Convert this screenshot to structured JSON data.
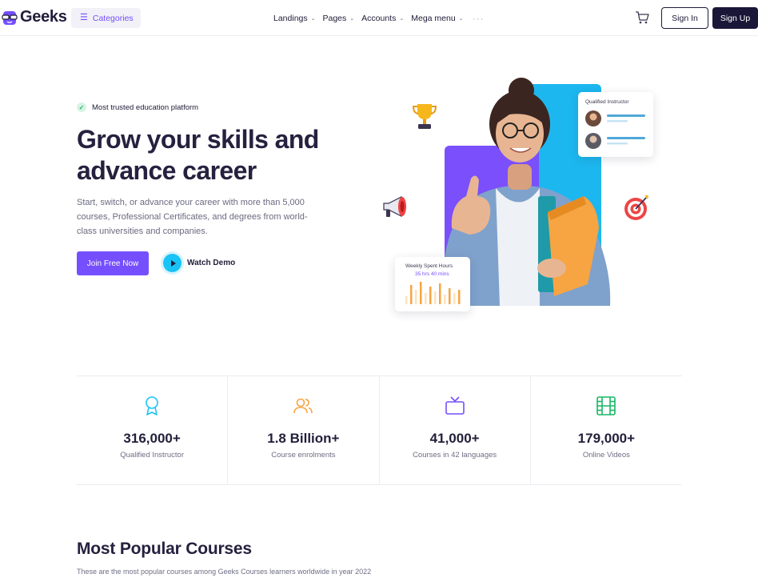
{
  "navbar": {
    "brand": "Geeks",
    "categories_label": "Categories",
    "menu": [
      {
        "label": "Landings"
      },
      {
        "label": "Pages"
      },
      {
        "label": "Accounts"
      },
      {
        "label": "Mega menu"
      }
    ],
    "more": "···",
    "signin_label": "Sign In",
    "signup_label": "Sign Up"
  },
  "hero": {
    "badge": "Most trusted education platform",
    "title_line1": "Grow your skills and",
    "title_line2": "advance career",
    "description": "Start, switch, or advance your career with more than 5,000 courses, Professional Certificates, and degrees from world-class universities and companies.",
    "join_label": "Join Free Now",
    "watch_label": "Watch Demo",
    "instructor_card_title": "Qualified Instructor",
    "hours_card_title": "Weekly Spent Hours",
    "hours_card_value": "35 hrs 40 mins"
  },
  "stats": [
    {
      "value": "316,000+",
      "label": "Qualified Instructor",
      "icon": "award-icon",
      "color": "#19c3f6"
    },
    {
      "value": "1.8 Billion+",
      "label": "Course enrolments",
      "icon": "users-icon",
      "color": "#f7a443"
    },
    {
      "value": "41,000+",
      "label": "Courses in 42 languages",
      "icon": "tv-icon",
      "color": "#754ffe"
    },
    {
      "value": "179,000+",
      "label": "Online Videos",
      "icon": "film-icon",
      "color": "#19b665"
    }
  ],
  "popular": {
    "title": "Most Popular Courses",
    "subtitle": "These are the most popular courses among Geeks Courses learners worldwide in year 2022"
  },
  "colors": {
    "primary": "#754ffe",
    "dark": "#1a1638",
    "accent_blue": "#19c3f6",
    "accent_orange": "#f7a443",
    "accent_green": "#19b665"
  }
}
